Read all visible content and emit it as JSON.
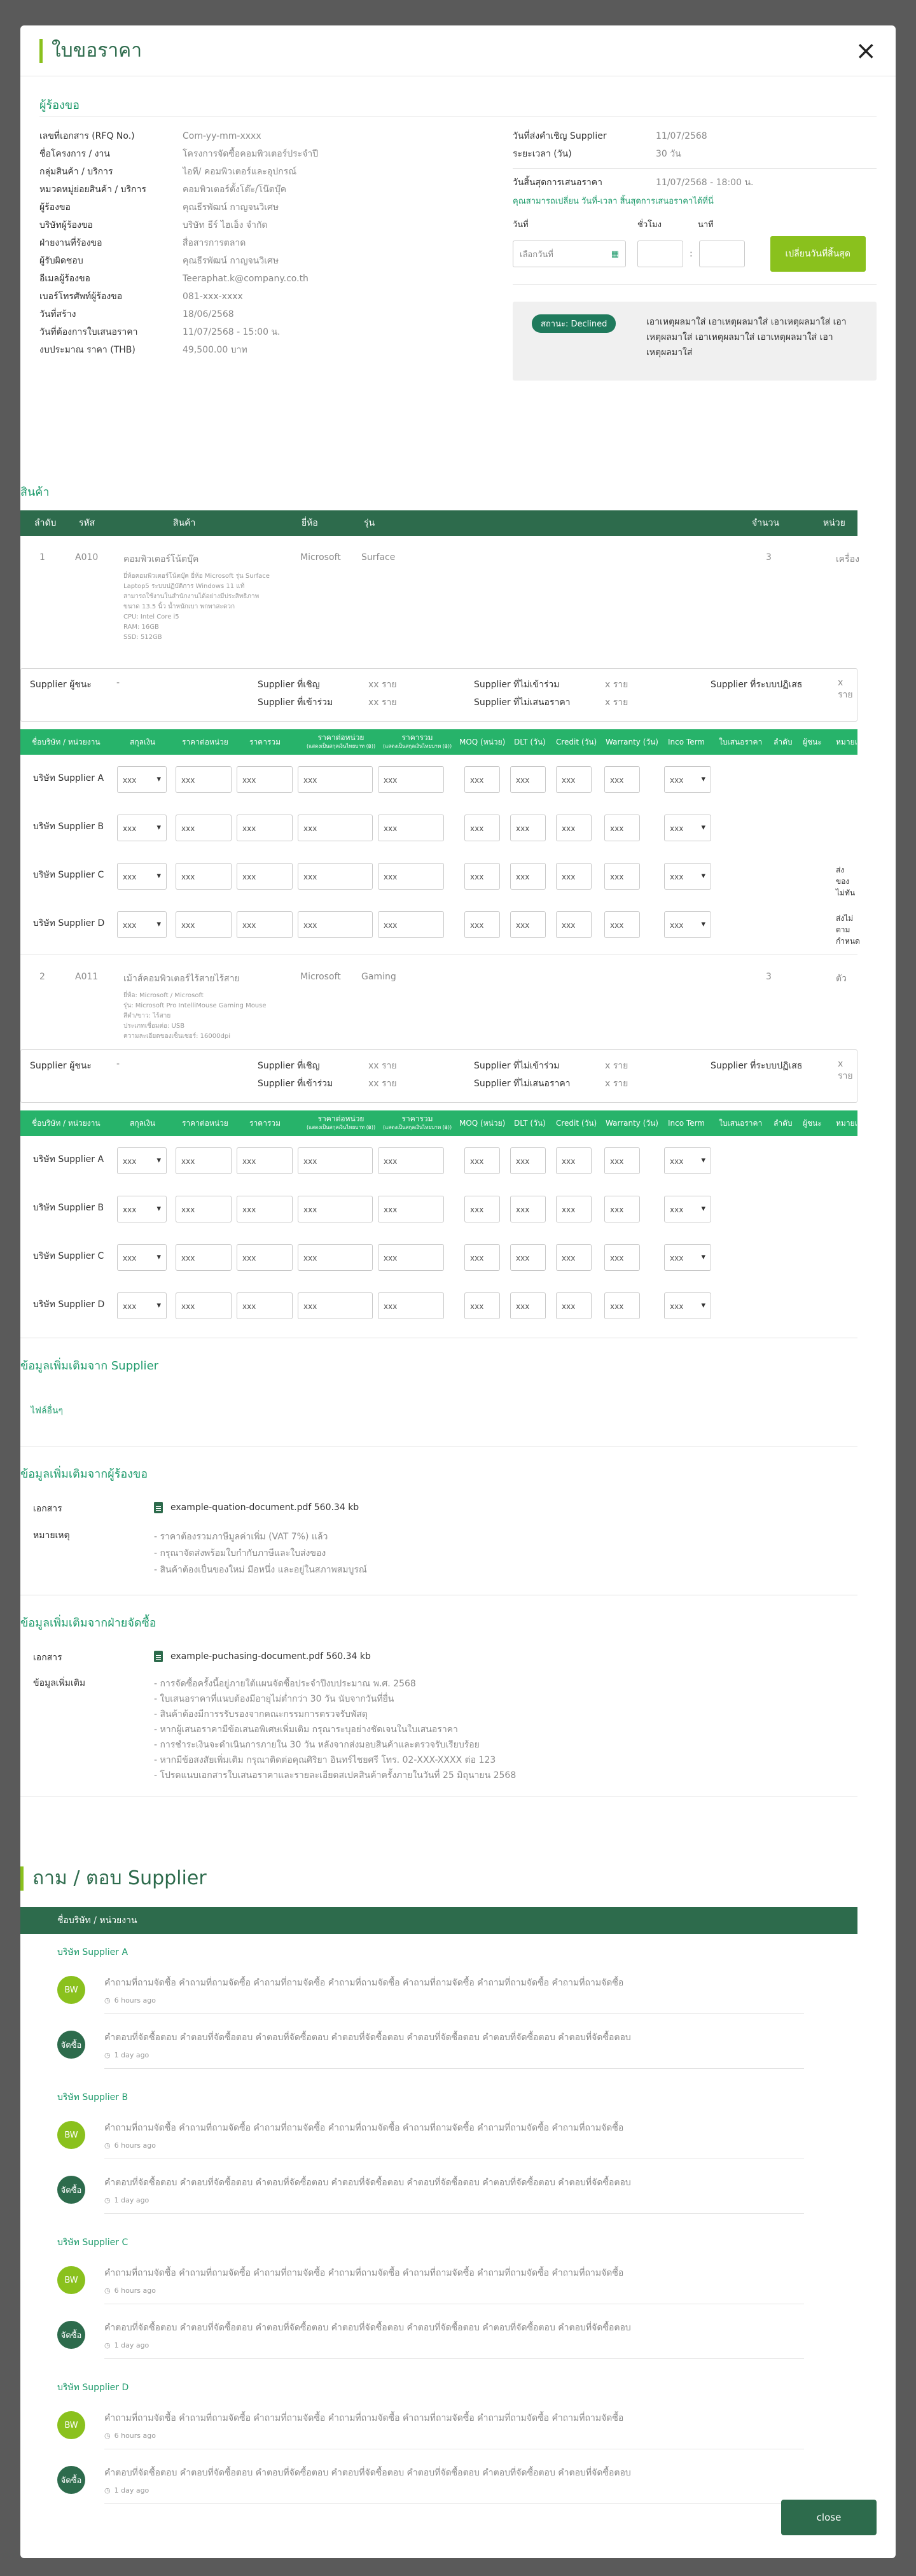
{
  "modal": {
    "title": "ใบขอราคา",
    "close": "×"
  },
  "requester": {
    "section": "ผู้ร้องขอ",
    "fields": [
      {
        "k": "เลขที่เอกสาร (RFQ No.)",
        "v": "Com-yy-mm-xxxx"
      },
      {
        "k": "ชื่อโครงการ / งาน",
        "v": "โครงการจัดซื้อคอมพิวเตอร์ประจำปี"
      },
      {
        "k": "กลุ่มสินค้า / บริการ",
        "v": "ไอที/ คอมพิวเตอร์และอุปกรณ์"
      },
      {
        "k": "หมวดหมู่ย่อยสินค้า / บริการ",
        "v": "คอมพิวเตอร์ตั้งโต๊ะ/โน๊ตบุ๊ค"
      },
      {
        "k": "ผู้ร้องขอ",
        "v": "คุณธีรพัฒน์ กาญจนวิเศษ"
      },
      {
        "k": "บริษัทผู้ร้องขอ",
        "v": "บริษัท ธีร์ ไฮเอ็ง จำกัด"
      },
      {
        "k": "ฝ่ายงานที่ร้องขอ",
        "v": "สื่อสารการตลาด"
      },
      {
        "k": "ผู้รับผิดชอบ",
        "v": "คุณธีรพัฒน์ กาญจนวิเศษ"
      },
      {
        "k": "อีเมลผู้ร้องขอ",
        "v": "Teeraphat.k@company.co.th"
      },
      {
        "k": "เบอร์โทรศัพท์ผู้ร้องขอ",
        "v": "081-xxx-xxxx"
      },
      {
        "k": "วันที่สร้าง",
        "v": "18/06/2568"
      },
      {
        "k": "วันที่ต้องการใบเสนอราคา",
        "v": "11/07/2568 - 15:00 น."
      },
      {
        "k": "งบประมาณ ราคา (THB)",
        "v": "49,500.00 บาท"
      }
    ]
  },
  "right": {
    "invite_k": "วันที่ส่งคำเชิญ Supplier",
    "invite_v": "11/07/2568",
    "period_k": "ระยะเวลา (วัน)",
    "period_v": "30 วัน",
    "deadline_k": "วันสิ้นสุดการเสนอราคา",
    "deadline_v": "11/07/2568 - 18:00 น.",
    "change_note": "คุณสามารถเปลี่ยน วันที่-เวลา สิ้นสุดการเสนอราคาได้ที่นี่",
    "date_label": "วันที่",
    "hour_label": "ชั่วโมง",
    "min_label": "นาที",
    "date_placeholder": "เลือกวันที่",
    "colon": ":",
    "change_btn": "เปลี่ยนวันที่สิ้นสุด",
    "status": "สถานะ: Declined",
    "reason": "เอาเหตุผลมาใส่ เอาเหตุผลมาใส่ เอาเหตุผลมาใส่ เอาเหตุผลมาใส่ เอาเหตุผลมาใส่ เอาเหตุผลมาใส่ เอาเหตุผลมาใส่"
  },
  "products": {
    "section": "สินค้า",
    "headers": [
      "ลำดับ",
      "รหัส",
      "สินค้า",
      "ยี่ห้อ",
      "รุ่น",
      "จำนวน",
      "หน่วย"
    ],
    "items": [
      {
        "no": "1",
        "code": "A010",
        "name": "คอมพิวเตอร์โน้ตบุ๊ค",
        "brand": "Microsoft",
        "model": "Surface",
        "qty": "3",
        "unit": "เครื่อง",
        "desc": [
          "ยี่ห้อคอมพิวเตอร์โน้ตบุ๊ค ยี่ห้อ Microsoft รุ่น Surface",
          "Laptop5 ระบบปฏิบัติการ Windows 11 แท้",
          "สามารถใช้งานในสำนักงานได้อย่างมีประสิทธิภาพ",
          "ขนาด 13.5 นิ้ว น้ำหนักเบา พกพาสะดวก",
          "CPU: Intel Core i5",
          "RAM: 16GB",
          "SSD: 512GB"
        ]
      },
      {
        "no": "2",
        "code": "A011",
        "name": "เม้าส์คอมพิวเตอร์ไร้สายไร้สาย",
        "brand": "Microsoft",
        "model": "Gaming",
        "qty": "3",
        "unit": "ตัว",
        "desc": [
          "ยี่ห้อ: Microsoft / Microsoft",
          "รุ่น: Microsoft Pro IntelliMouse Gaming Mouse",
          "สีดำ/ขาว: ไร้สาย",
          "ประเภทเชื่อมต่อ: USB",
          "ความละเอียดของเซ็นเซอร์: 16000dpi"
        ]
      }
    ]
  },
  "supsum": {
    "label": "Supplier ผู้ชนะ",
    "dash": "-",
    "invited": "Supplier ที่เชิญ",
    "joined": "Supplier ที่เข้าร่วม",
    "notjoined": "Supplier ที่ไม่เข้าร่วม",
    "notsent": "Supplier ที่ไม่เสนอราคา",
    "rejected": "Supplier ที่ระบบปฏิเสธ",
    "n": "xx ราย",
    "n2": "x ราย"
  },
  "suphead": [
    "ชื่อบริษัท / หน่วยงาน",
    "สกุลเงิน",
    "ราคาต่อหน่วย",
    "ราคารวม",
    "ราคาต่อหน่วย",
    "(แสดงเป็นสกุลเงินไทยบาท (฿))",
    "ราคารวม",
    "(แสดงเป็นสกุลเงินไทยบาท (฿))",
    "MOQ (หน่วย)",
    "DLT (วัน)",
    "Credit (วัน)",
    "Warranty (วัน)",
    "Inco Term",
    "ใบเสนอราคา",
    "ลำดับ",
    "ผู้ชนะ",
    "หมายเหตุ"
  ],
  "suppliers": [
    {
      "name": "บริษัท Supplier A",
      "note": ""
    },
    {
      "name": "บริษัท Supplier B",
      "note": ""
    },
    {
      "name": "บริษัท Supplier C",
      "note": "ส่งของไม่ทัน"
    },
    {
      "name": "บริษัท Supplier D",
      "note": "ส่งไม่ตามกำหนด"
    }
  ],
  "suppliers2": [
    {
      "name": "บริษัท Supplier A"
    },
    {
      "name": "บริษัท Supplier B"
    },
    {
      "name": "บริษัท Supplier C"
    },
    {
      "name": "บริษัท Supplier D"
    }
  ],
  "xxx": "xxx",
  "extra_supplier": {
    "section": "ข้อมูลเพิ่มเติมจาก Supplier",
    "file": "ไฟล์อื่นๆ"
  },
  "extra_requester": {
    "section": "ข้อมูลเพิ่มเติมจากผู้ร้องขอ",
    "doc_k": "เอกสาร",
    "doc_v": "example-quation-document.pdf 560.34 kb",
    "note_k": "หมายเหตุ",
    "notes": [
      "- ราคาต้องรวมภาษีมูลค่าเพิ่ม (VAT 7%) แล้ว",
      "- กรุณาจัดส่งพร้อมใบกำกับภาษีและใบส่งของ",
      "- สินค้าต้องเป็นของใหม่ มือหนึ่ง และอยู่ในสภาพสมบูรณ์"
    ]
  },
  "extra_buyer": {
    "section": "ข้อมูลเพิ่มเติมจากฝ่ายจัดซื้อ",
    "doc_k": "เอกสาร",
    "doc_v": "example-puchasing-document.pdf 560.34 kb",
    "note_k": "ข้อมูลเพิ่มเติม",
    "notes": [
      "- การจัดซื้อครั้งนี้อยู่ภายใต้แผนจัดซื้อประจำปีงบประมาณ พ.ศ. 2568",
      "- ใบเสนอราคาที่แนบต้องมีอายุไม่ต่ำกว่า 30 วัน นับจากวันที่ยื่น",
      "- สินค้าต้องมีการรรับรองจากคณะกรรมการตรวจรับพัสดุ",
      "- หากผู้เสนอราคามีข้อเสนอพิเศษเพิ่มเติม กรุณาระบุอย่างชัดเจนในใบเสนอราคา",
      "- การชำระเงินจะดำเนินการภายใน 30 วัน หลังจากส่งมอบสินค้าและตรวจรับเรียบร้อย",
      "- หากมีข้อสงสัยเพิ่มเติม กรุณาติดต่อคุณศิริยา อินทร์ไชยศรี โทร. 02-XXX-XXXX ต่อ 123",
      "- โปรดแนบเอกสารใบเสนอราคาและรายละเอียดสเปคสินค้าครั้งภายในวันที่ 25 มิถุนายน 2568"
    ]
  },
  "qa": {
    "title": "ถาม / ตอบ Supplier",
    "header": "ชื่อบริษัท / หน่วยงาน",
    "groups": [
      "บริษัท Supplier A",
      "บริษัท Supplier B",
      "บริษัท Supplier C",
      "บริษัท Supplier D"
    ],
    "q_avatar": "BW",
    "a_avatar": "จัดซื้อ",
    "q_text": "คำถามที่ถามจัดซื้อ คำถามที่ถามจัดซื้อ คำถามที่ถามจัดซื้อ คำถามที่ถามจัดซื้อ คำถามที่ถามจัดซื้อ คำถามที่ถามจัดซื้อ คำถามที่ถามจัดซื้อ",
    "q_time": "6 hours ago",
    "a_text": "คำตอบที่จัดซื้อตอบ คำตอบที่จัดซื้อตอบ คำตอบที่จัดซื้อตอบ คำตอบที่จัดซื้อตอบ คำตอบที่จัดซื้อตอบ คำตอบที่จัดซื้อตอบ คำตอบที่จัดซื้อตอบ",
    "a_time": "1 day ago"
  },
  "close": "close",
  "colors": {
    "dark": "#2d6b4c",
    "accent": "#8ac11d",
    "teal": "#1f9b6c",
    "bright": "#27b36a"
  }
}
